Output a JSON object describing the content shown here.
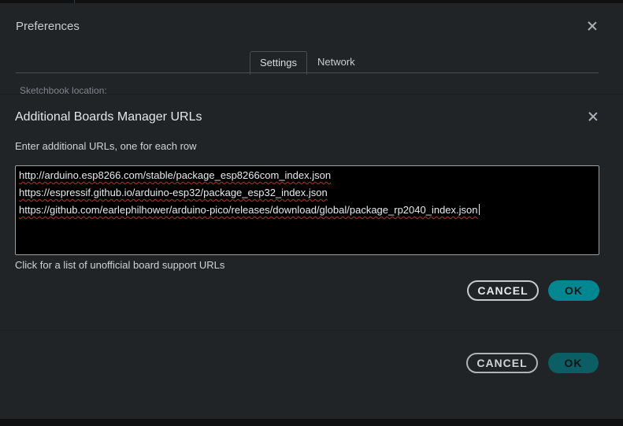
{
  "preferences": {
    "title": "Preferences",
    "tabs": [
      {
        "label": "Settings",
        "active": true
      },
      {
        "label": "Network",
        "active": false
      }
    ],
    "sketchbook_label": "Sketchbook location:",
    "cancel_label": "CANCEL",
    "ok_label": "OK"
  },
  "boards_dialog": {
    "title": "Additional Boards Manager URLs",
    "hint": "Enter additional URLs, one for each row",
    "urls": [
      "http://arduino.esp8266.com/stable/package_esp8266com_index.json",
      "https://espressif.github.io/arduino-esp32/package_esp32_index.json",
      "https://github.com/earlephilhower/arduino-pico/releases/download/global/package_rp2040_index.json"
    ],
    "link_text": "Click for a list of unofficial board support URLs",
    "cancel_label": "CANCEL",
    "ok_label": "OK"
  },
  "colors": {
    "accent": "#00878f",
    "background": "#202426",
    "spellcheck": "#d32222"
  },
  "icons": {
    "close": "close-icon"
  }
}
